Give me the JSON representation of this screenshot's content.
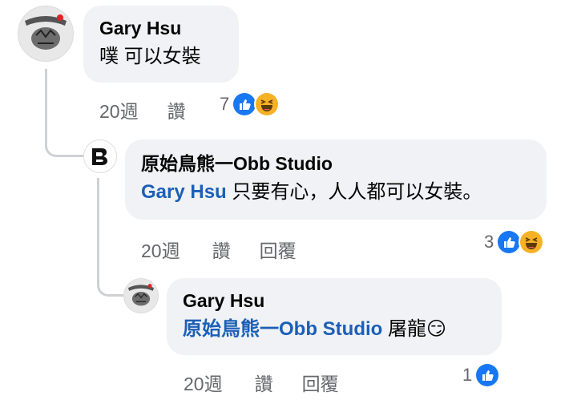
{
  "comments": [
    {
      "author": "Gary Hsu",
      "text": "噗 可以女裝",
      "time": "20週",
      "like_label": "讚",
      "reaction_count": "7",
      "reactions": [
        "like-icon",
        "haha-icon"
      ]
    },
    {
      "author": "原始鳥熊一Obb Studio",
      "mention": "Gary Hsu",
      "text": " 只要有心，人人都可以女裝。",
      "time": "20週",
      "like_label": "讚",
      "reply_label": "回覆",
      "reaction_count": "3",
      "reactions": [
        "like-icon",
        "haha-icon"
      ]
    },
    {
      "author": "Gary Hsu",
      "mention": "原始鳥熊一Obb Studio",
      "text": " 屠龍😏",
      "time": "20週",
      "like_label": "讚",
      "reply_label": "回覆",
      "reaction_count": "1",
      "reactions": [
        "like-icon"
      ]
    }
  ],
  "colors": {
    "bubble": "#f0f2f5",
    "mention": "#1b5fb8",
    "meta": "#65676b",
    "like": "#1877f2",
    "haha": "#f7b125"
  }
}
